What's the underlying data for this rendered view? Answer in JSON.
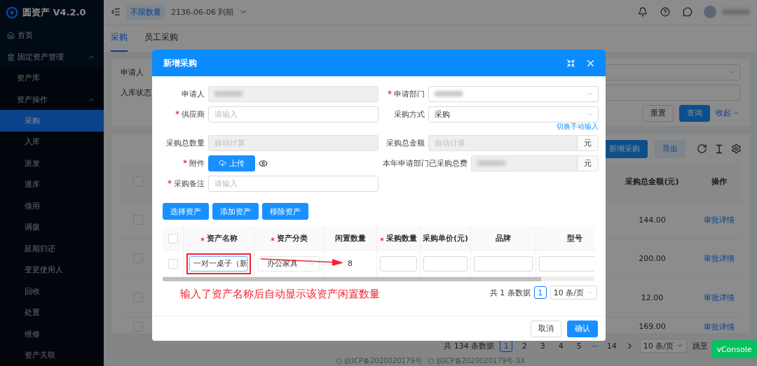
{
  "sidebar": {
    "logo": "圆资产 V4.2.0",
    "items": [
      {
        "label": "首页",
        "kind": "home",
        "selected": false
      },
      {
        "label": "固定资产管理",
        "kind": "group",
        "selected": false,
        "expanded": true,
        "children": [
          {
            "label": "资产库",
            "selected": false
          },
          {
            "label": "资产操作",
            "selected": false,
            "expanded": true,
            "children": [
              {
                "label": "采购",
                "selected": true
              },
              {
                "label": "入库",
                "selected": false
              },
              {
                "label": "派发",
                "selected": false
              },
              {
                "label": "退库",
                "selected": false
              },
              {
                "label": "借用",
                "selected": false
              },
              {
                "label": "调拨",
                "selected": false
              },
              {
                "label": "延期归还",
                "selected": false
              },
              {
                "label": "变更使用人",
                "selected": false
              },
              {
                "label": "回收",
                "selected": false
              },
              {
                "label": "处置",
                "selected": false
              },
              {
                "label": "维修",
                "selected": false
              },
              {
                "label": "资产关联",
                "selected": false
              }
            ]
          }
        ]
      }
    ]
  },
  "header": {
    "badge": "不限数量",
    "expiry": "2136-06-06 到期"
  },
  "page_tabs": [
    {
      "label": "采购",
      "selected": true
    },
    {
      "label": "员工采购",
      "selected": false
    }
  ],
  "filter": {
    "fields": [
      {
        "label": "申请人",
        "kind": "select"
      },
      {
        "label": "入库状态",
        "kind": "input"
      }
    ],
    "buttons": [
      {
        "label": "重置",
        "kind": "default"
      },
      {
        "label": "查询",
        "kind": "primary"
      }
    ],
    "collapse": "收起"
  },
  "toolbar": {
    "buttons": [
      {
        "label": "新增采购",
        "kind": "primary"
      },
      {
        "label": "导出",
        "kind": "light"
      }
    ]
  },
  "table": {
    "header_checked": false,
    "columns": [
      "采购总金额(元)",
      "操作"
    ],
    "rows": [
      {
        "checked": false,
        "amount": "144.00",
        "action": "审批详情"
      },
      {
        "checked": false,
        "amount": "200.00",
        "action": "审批详情"
      },
      {
        "checked": false,
        "amount": "12.00",
        "action": "审批详情"
      },
      {
        "checked": false,
        "amount": "169.00",
        "action": "审批详情"
      }
    ]
  },
  "pagination": {
    "total": "共 134 条数据",
    "pages": [
      {
        "label": "1",
        "selected": true
      },
      {
        "label": "2",
        "selected": false
      },
      {
        "label": "3",
        "selected": false
      },
      {
        "label": "4",
        "selected": false
      },
      {
        "label": "5",
        "selected": false
      }
    ],
    "ellipsis": "···",
    "last": "14",
    "page_size": "10 条/页",
    "jump": "跳至"
  },
  "footer": [
    "皖ICP备2020020179号",
    "皖ICP备2020020179号-3X"
  ],
  "vconsole": "vConsole",
  "modal": {
    "title": "新增采购",
    "form_rows": [
      {
        "left": {
          "label": "申请人",
          "required": false,
          "kind": "input",
          "disabled": true,
          "redacted": true
        },
        "right": {
          "label": "申请部门",
          "required": true,
          "kind": "select",
          "disabled": false,
          "redacted": true
        }
      },
      {
        "left": {
          "label": "供应商",
          "required": true,
          "kind": "input",
          "disabled": false,
          "placeholder": "请输入"
        },
        "right": {
          "label": "采购方式",
          "required": false,
          "kind": "select",
          "disabled": false,
          "value": "采购",
          "link": "切换手动输入"
        }
      },
      {
        "left": {
          "label": "采购总数量",
          "required": false,
          "kind": "input",
          "disabled": true,
          "placeholder": "自动计算"
        },
        "right": {
          "label": "采购总金额",
          "required": false,
          "kind": "input",
          "disabled": true,
          "placeholder": "自动计算",
          "suffix": "元"
        }
      },
      {
        "left": {
          "label": "附件",
          "required": true,
          "kind": "upload",
          "button": "上传"
        },
        "right": {
          "label": "本年申请部门已采购总费",
          "required": false,
          "kind": "input",
          "disabled": true,
          "redacted": true,
          "suffix": "元"
        }
      },
      {
        "left": {
          "label": "采购备注",
          "required": true,
          "kind": "input",
          "disabled": false,
          "placeholder": "请输入"
        }
      }
    ],
    "actions": [
      "选择资产",
      "添加资产",
      "移除资产"
    ],
    "table": {
      "header_checked": false,
      "columns": [
        {
          "label": "资产名称",
          "required": true
        },
        {
          "label": "资产分类",
          "required": true
        },
        {
          "label": "闲置数量",
          "required": false
        },
        {
          "label": "采购数量",
          "required": true
        },
        {
          "label": "采购单价(元)",
          "required": false
        },
        {
          "label": "品牌",
          "required": false
        },
        {
          "label": "型号",
          "required": false
        }
      ],
      "rows": [
        {
          "checked": false,
          "name": "一对一桌子（新",
          "category": "办公家具",
          "idle": "8"
        }
      ]
    },
    "annotation": "输入了资产名称后自动显示该资产闲置数量",
    "pagination": {
      "total": "共 1 条数据",
      "pages": [
        {
          "label": "1",
          "selected": true
        }
      ],
      "page_size": "10 条/页"
    },
    "buttons": [
      {
        "label": "取消",
        "kind": "default"
      },
      {
        "label": "确认",
        "kind": "primary"
      }
    ]
  }
}
